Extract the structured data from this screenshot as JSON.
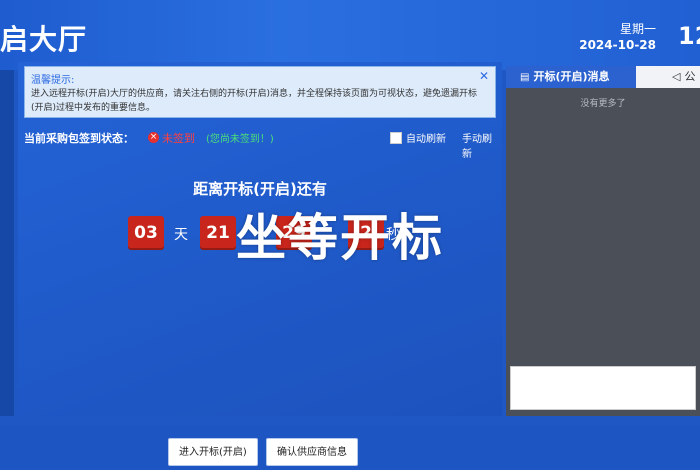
{
  "header": {
    "title": "启大厅",
    "weekday": "星期一",
    "date": "2024-10-28",
    "clock_partial": "12"
  },
  "notice": {
    "title": "温馨提示:",
    "body": "进入远程开标(开启)大厅的供应商，请关注右侧的开标(开启)消息，并全程保持该页面为可视状态，避免遗漏开标(开启)过程中发布的重要信息。",
    "close_icon": "close-icon"
  },
  "status": {
    "label": "当前采购包签到状态：",
    "value": "未签到",
    "hint": "(您尚未签到！)",
    "auto_refresh_label": "自动刷新",
    "manual_refresh_label": "手动刷新",
    "dot_glyph": "×",
    "colors": {
      "error": "#e53030",
      "hint": "#4be07a"
    }
  },
  "countdown": {
    "title": "距离开标(开启)还有",
    "days": "03",
    "days_unit": "天",
    "hours": "21",
    "minutes": "29",
    "seconds": "2",
    "seconds_unit": "秒",
    "box_color": "#c8251c"
  },
  "overlay_text": "坐等开标",
  "right_panel": {
    "tabs": [
      {
        "label": "开标(开启)消息",
        "icon": "message-icon",
        "active": true
      },
      {
        "label": "公",
        "icon": "speaker-icon",
        "active": false
      }
    ],
    "empty_text": "没有更多了"
  },
  "footer": {
    "buttons": [
      "进入开标(开启)",
      "确认供应商信息"
    ]
  }
}
